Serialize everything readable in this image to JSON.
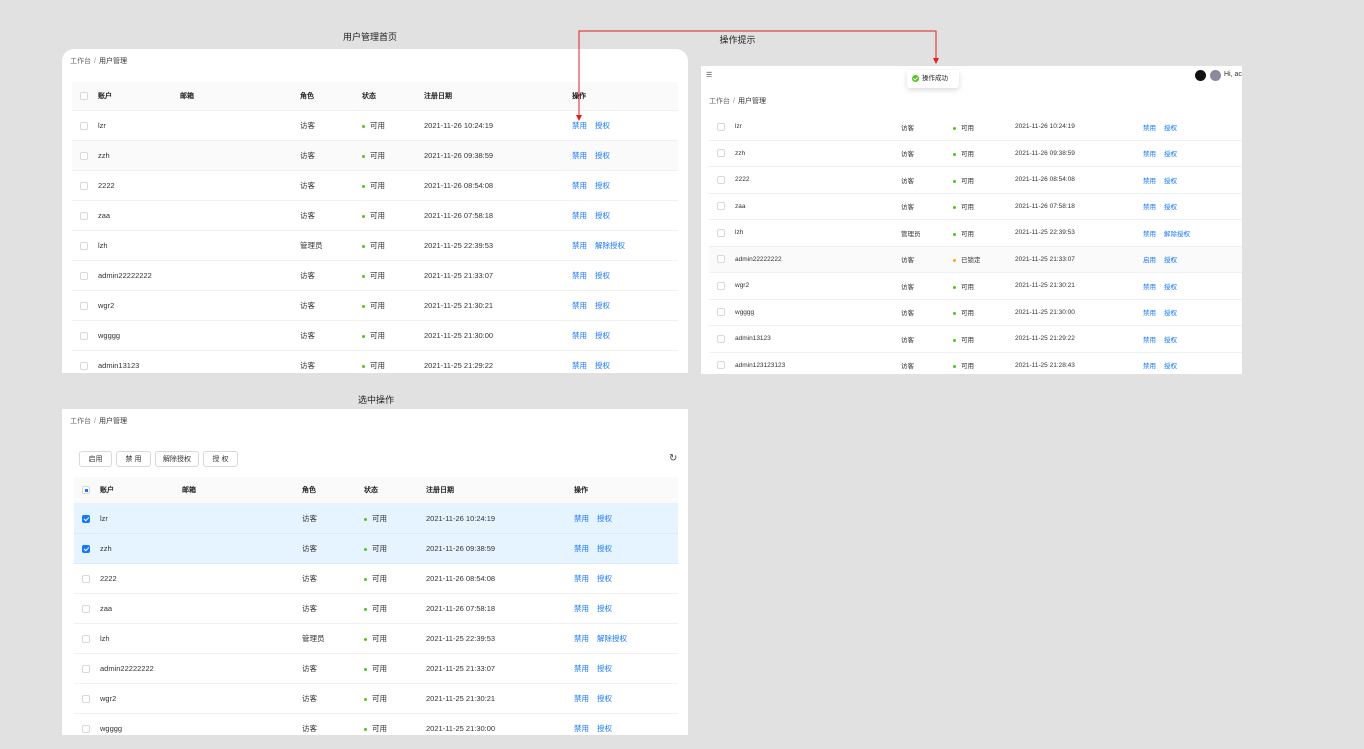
{
  "titles": {
    "home": "用户管理首页",
    "tip": "操作提示",
    "select": "选中操作"
  },
  "breadcrumb": {
    "root": "工作台",
    "separator": "/",
    "current": "用户管理"
  },
  "columns": {
    "account": "账户",
    "email": "邮箱",
    "role": "角色",
    "status": "状态",
    "date": "注册日期",
    "actions": "操作"
  },
  "toolbar": {
    "enable": "启用",
    "disable": "禁 用",
    "revoke": "解除授权",
    "grant": "授 权",
    "refresh_icon": "refresh-icon"
  },
  "toast": {
    "message": "操作成功",
    "icon": "check-circle-icon"
  },
  "header": {
    "menu_icon": "menu-icon",
    "github_icon": "github-icon",
    "greeting": "Hi, ac"
  },
  "colors": {
    "primary": "#1677ff",
    "success": "#52c41a",
    "warning": "#faad14",
    "arrow": "#e02020"
  },
  "table_home": [
    {
      "account": "lzr",
      "role": "访客",
      "status": "可用",
      "date": "2021-11-26 10:24:19",
      "action1": "禁用",
      "action2": "授权"
    },
    {
      "account": "zzh",
      "role": "访客",
      "status": "可用",
      "date": "2021-11-26 09:38:59",
      "action1": "禁用",
      "action2": "授权"
    },
    {
      "account": "2222",
      "role": "访客",
      "status": "可用",
      "date": "2021-11-26 08:54:08",
      "action1": "禁用",
      "action2": "授权"
    },
    {
      "account": "zaa",
      "role": "访客",
      "status": "可用",
      "date": "2021-11-26 07:58:18",
      "action1": "禁用",
      "action2": "授权"
    },
    {
      "account": "lzh",
      "role": "管理员",
      "status": "可用",
      "date": "2021-11-25 22:39:53",
      "action1": "禁用",
      "action2": "解除授权"
    },
    {
      "account": "admin22222222",
      "role": "访客",
      "status": "可用",
      "date": "2021-11-25 21:33:07",
      "action1": "禁用",
      "action2": "授权"
    },
    {
      "account": "wgr2",
      "role": "访客",
      "status": "可用",
      "date": "2021-11-25 21:30:21",
      "action1": "禁用",
      "action2": "授权"
    },
    {
      "account": "wgggg",
      "role": "访客",
      "status": "可用",
      "date": "2021-11-25 21:30:00",
      "action1": "禁用",
      "action2": "授权"
    },
    {
      "account": "admin13123",
      "role": "访客",
      "status": "可用",
      "date": "2021-11-25 21:29:22",
      "action1": "禁用",
      "action2": "授权"
    }
  ],
  "table_tip": [
    {
      "account": "lzr",
      "role": "访客",
      "status": "可用",
      "date": "2021-11-26 10:24:19",
      "action1": "禁用",
      "action2": "授权"
    },
    {
      "account": "zzh",
      "role": "访客",
      "status": "可用",
      "date": "2021-11-26 09:38:59",
      "action1": "禁用",
      "action2": "授权"
    },
    {
      "account": "2222",
      "role": "访客",
      "status": "可用",
      "date": "2021-11-26 08:54:08",
      "action1": "禁用",
      "action2": "授权"
    },
    {
      "account": "zaa",
      "role": "访客",
      "status": "可用",
      "date": "2021-11-26 07:58:18",
      "action1": "禁用",
      "action2": "授权"
    },
    {
      "account": "lzh",
      "role": "管理员",
      "status": "可用",
      "date": "2021-11-25 22:39:53",
      "action1": "禁用",
      "action2": "解除授权"
    },
    {
      "account": "admin22222222",
      "role": "访客",
      "status": "已锁定",
      "date": "2021-11-25 21:33:07",
      "action1": "启用",
      "action2": "授权",
      "locked": true
    },
    {
      "account": "wgr2",
      "role": "访客",
      "status": "可用",
      "date": "2021-11-25 21:30:21",
      "action1": "禁用",
      "action2": "授权"
    },
    {
      "account": "wgggg",
      "role": "访客",
      "status": "可用",
      "date": "2021-11-25 21:30:00",
      "action1": "禁用",
      "action2": "授权"
    },
    {
      "account": "admin13123",
      "role": "访客",
      "status": "可用",
      "date": "2021-11-25 21:29:22",
      "action1": "禁用",
      "action2": "授权"
    },
    {
      "account": "admin123123123",
      "role": "访客",
      "status": "可用",
      "date": "2021-11-25 21:28:43",
      "action1": "禁用",
      "action2": "授权"
    }
  ],
  "table_select": [
    {
      "account": "lzr",
      "role": "访客",
      "status": "可用",
      "date": "2021-11-26 10:24:19",
      "action1": "禁用",
      "action2": "授权",
      "checked": true
    },
    {
      "account": "zzh",
      "role": "访客",
      "status": "可用",
      "date": "2021-11-26 09:38:59",
      "action1": "禁用",
      "action2": "授权",
      "checked": true
    },
    {
      "account": "2222",
      "role": "访客",
      "status": "可用",
      "date": "2021-11-26 08:54:08",
      "action1": "禁用",
      "action2": "授权"
    },
    {
      "account": "zaa",
      "role": "访客",
      "status": "可用",
      "date": "2021-11-26 07:58:18",
      "action1": "禁用",
      "action2": "授权"
    },
    {
      "account": "lzh",
      "role": "管理员",
      "status": "可用",
      "date": "2021-11-25 22:39:53",
      "action1": "禁用",
      "action2": "解除授权"
    },
    {
      "account": "admin22222222",
      "role": "访客",
      "status": "可用",
      "date": "2021-11-25 21:33:07",
      "action1": "禁用",
      "action2": "授权"
    },
    {
      "account": "wgr2",
      "role": "访客",
      "status": "可用",
      "date": "2021-11-25 21:30:21",
      "action1": "禁用",
      "action2": "授权"
    },
    {
      "account": "wgggg",
      "role": "访客",
      "status": "可用",
      "date": "2021-11-25 21:30:00",
      "action1": "禁用",
      "action2": "授权"
    }
  ]
}
